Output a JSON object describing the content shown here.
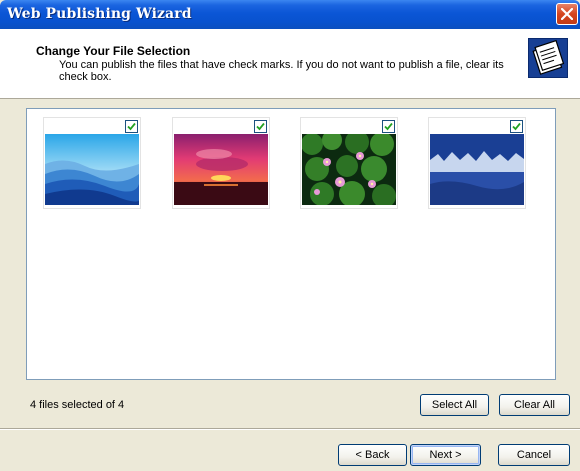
{
  "window": {
    "title": "Web Publishing Wizard",
    "close_icon": "close-icon"
  },
  "header": {
    "title": "Change Your File Selection",
    "description": "You can publish the files that have check marks.  If you do not want to publish a file, clear its check box.",
    "icon": "web-publishing-wizard-icon"
  },
  "files": [
    {
      "name": "blue-hills-thumbnail",
      "checked": true
    },
    {
      "name": "sunset-thumbnail",
      "checked": true
    },
    {
      "name": "water-lilies-thumbnail",
      "checked": true
    },
    {
      "name": "winter-thumbnail",
      "checked": true
    }
  ],
  "status": {
    "text": "4 files selected of 4"
  },
  "buttons": {
    "select_all": "Select All",
    "clear_all": "Clear All",
    "back": "< Back",
    "next": "Next >",
    "cancel": "Cancel"
  },
  "colors": {
    "titlebar": "#0b56d6",
    "dialog_bg": "#ece9d8",
    "check_green": "#21a121"
  }
}
